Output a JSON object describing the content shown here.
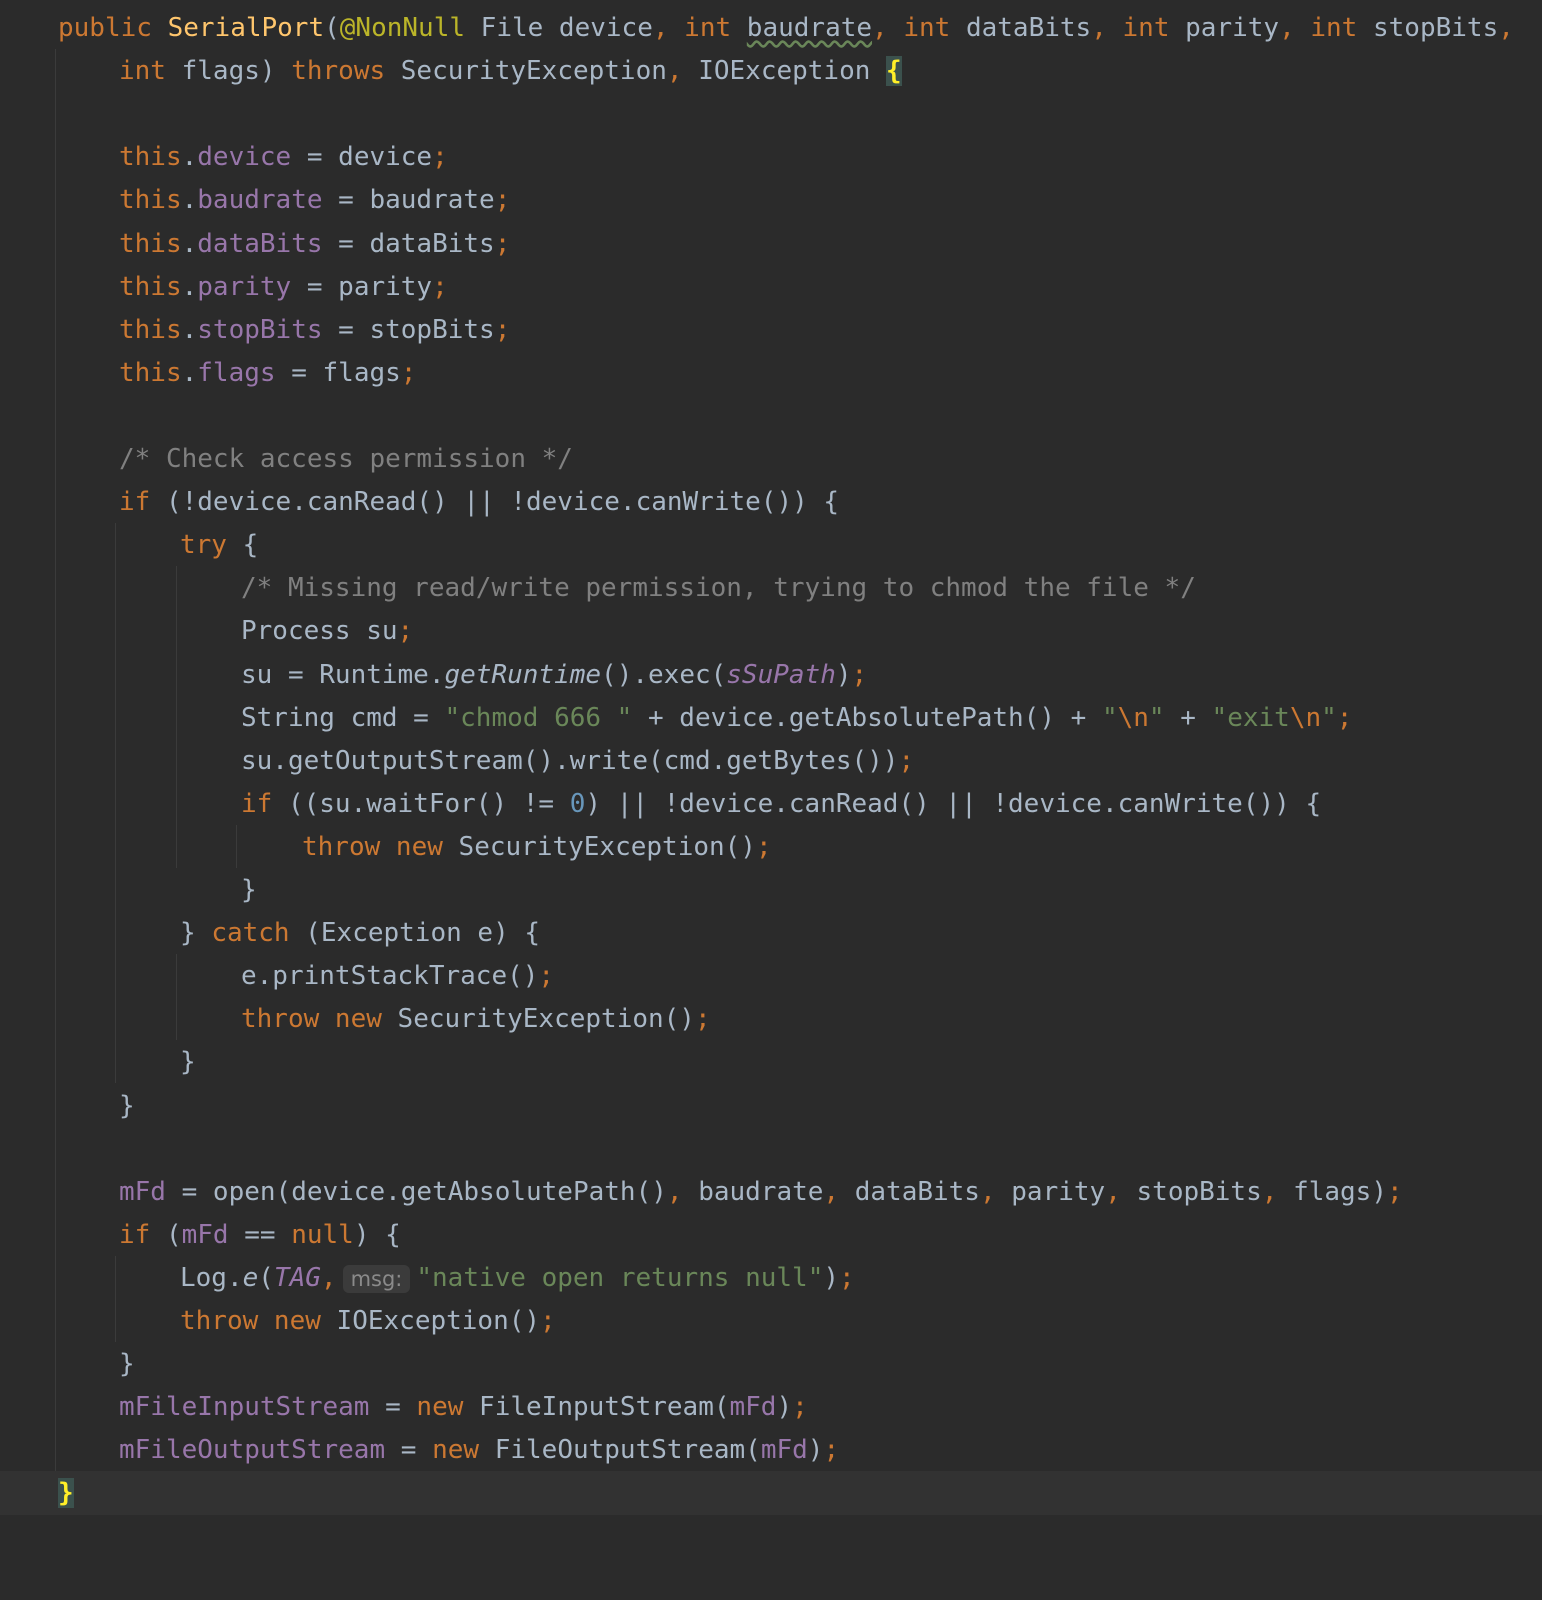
{
  "editor": {
    "language": "Java",
    "theme_colors": {
      "background": "#2b2b2b",
      "current_line": "#323232",
      "default_text": "#a9b7c6",
      "keyword": "#cc7832",
      "method_declaration": "#ffc66d",
      "annotation": "#bbb529",
      "field": "#9876aa",
      "string": "#6a8759",
      "number": "#6897bb",
      "comment": "#808080",
      "matched_brace": "#ffef28"
    },
    "lines": [
      [
        {
          "t": "public ",
          "c": "kw"
        },
        {
          "t": "SerialPort",
          "c": "fn"
        },
        {
          "t": "("
        },
        {
          "t": "@NonNull",
          "c": "ann"
        },
        {
          "t": " File device"
        },
        {
          "t": ", ",
          "c": "kw"
        },
        {
          "t": "int ",
          "c": "kw"
        },
        {
          "t": "baudrate",
          "c": "warn"
        },
        {
          "t": ", ",
          "c": "kw"
        },
        {
          "t": "int ",
          "c": "kw"
        },
        {
          "t": "dataBits"
        },
        {
          "t": ", ",
          "c": "kw"
        },
        {
          "t": "int ",
          "c": "kw"
        },
        {
          "t": "parity"
        },
        {
          "t": ", ",
          "c": "kw"
        },
        {
          "t": "int ",
          "c": "kw"
        },
        {
          "t": "stopBits"
        },
        {
          "t": ",",
          "c": "kw"
        }
      ],
      [
        {
          "t": "int ",
          "c": "kw"
        },
        {
          "t": "flags) "
        },
        {
          "t": "throws ",
          "c": "kw"
        },
        {
          "t": "SecurityException"
        },
        {
          "t": ", ",
          "c": "kw"
        },
        {
          "t": "IOException "
        },
        {
          "t": "{",
          "c": "brace-hl"
        }
      ],
      [],
      [
        {
          "t": "this",
          "c": "kw"
        },
        {
          "t": "."
        },
        {
          "t": "device",
          "c": "fld"
        },
        {
          "t": " = device"
        },
        {
          "t": ";",
          "c": "kw"
        }
      ],
      [
        {
          "t": "this",
          "c": "kw"
        },
        {
          "t": "."
        },
        {
          "t": "baudrate",
          "c": "fld"
        },
        {
          "t": " = baudrate"
        },
        {
          "t": ";",
          "c": "kw"
        }
      ],
      [
        {
          "t": "this",
          "c": "kw"
        },
        {
          "t": "."
        },
        {
          "t": "dataBits",
          "c": "fld"
        },
        {
          "t": " = dataBits"
        },
        {
          "t": ";",
          "c": "kw"
        }
      ],
      [
        {
          "t": "this",
          "c": "kw"
        },
        {
          "t": "."
        },
        {
          "t": "parity",
          "c": "fld"
        },
        {
          "t": " = parity"
        },
        {
          "t": ";",
          "c": "kw"
        }
      ],
      [
        {
          "t": "this",
          "c": "kw"
        },
        {
          "t": "."
        },
        {
          "t": "stopBits",
          "c": "fld"
        },
        {
          "t": " = stopBits"
        },
        {
          "t": ";",
          "c": "kw"
        }
      ],
      [
        {
          "t": "this",
          "c": "kw"
        },
        {
          "t": "."
        },
        {
          "t": "flags",
          "c": "fld"
        },
        {
          "t": " = flags"
        },
        {
          "t": ";",
          "c": "kw"
        }
      ],
      [],
      [
        {
          "t": "/* Check access permission */",
          "c": "cmt"
        }
      ],
      [
        {
          "t": "if ",
          "c": "kw"
        },
        {
          "t": "(!device.canRead() || !device.canWrite()) {"
        }
      ],
      [
        {
          "t": "try ",
          "c": "kw"
        },
        {
          "t": "{"
        }
      ],
      [
        {
          "t": "/* Missing read/write permission, trying to chmod the file */",
          "c": "cmt"
        }
      ],
      [
        {
          "t": "Process su"
        },
        {
          "t": ";",
          "c": "kw"
        }
      ],
      [
        {
          "t": "su = Runtime."
        },
        {
          "t": "getRuntime",
          "c": "ital"
        },
        {
          "t": "().exec("
        },
        {
          "t": "sSuPath",
          "c": "fldi"
        },
        {
          "t": ")"
        },
        {
          "t": ";",
          "c": "kw"
        }
      ],
      [
        {
          "t": "String cmd = "
        },
        {
          "t": "\"chmod 666 \"",
          "c": "str"
        },
        {
          "t": " + device.getAbsolutePath() + "
        },
        {
          "t": "\"",
          "c": "str"
        },
        {
          "t": "\\n",
          "c": "esc"
        },
        {
          "t": "\"",
          "c": "str"
        },
        {
          "t": " + "
        },
        {
          "t": "\"exit",
          "c": "str"
        },
        {
          "t": "\\n",
          "c": "esc"
        },
        {
          "t": "\"",
          "c": "str"
        },
        {
          "t": ";",
          "c": "kw"
        }
      ],
      [
        {
          "t": "su.getOutputStream().write(cmd.getBytes())"
        },
        {
          "t": ";",
          "c": "kw"
        }
      ],
      [
        {
          "t": "if ",
          "c": "kw"
        },
        {
          "t": "((su.waitFor() != "
        },
        {
          "t": "0",
          "c": "num"
        },
        {
          "t": ") || !device.canRead() || !device.canWrite()) {"
        }
      ],
      [
        {
          "t": "throw new ",
          "c": "kw"
        },
        {
          "t": "SecurityException()"
        },
        {
          "t": ";",
          "c": "kw"
        }
      ],
      [
        {
          "t": "}"
        }
      ],
      [
        {
          "t": "} "
        },
        {
          "t": "catch ",
          "c": "kw"
        },
        {
          "t": "(Exception e) {"
        }
      ],
      [
        {
          "t": "e.printStackTrace()"
        },
        {
          "t": ";",
          "c": "kw"
        }
      ],
      [
        {
          "t": "throw new ",
          "c": "kw"
        },
        {
          "t": "SecurityException()"
        },
        {
          "t": ";",
          "c": "kw"
        }
      ],
      [
        {
          "t": "}"
        }
      ],
      [
        {
          "t": "}"
        }
      ],
      [],
      [
        {
          "t": "mFd",
          "c": "fld"
        },
        {
          "t": " = open(device.getAbsolutePath()"
        },
        {
          "t": ", ",
          "c": "kw"
        },
        {
          "t": "baudrate"
        },
        {
          "t": ", ",
          "c": "kw"
        },
        {
          "t": "dataBits"
        },
        {
          "t": ", ",
          "c": "kw"
        },
        {
          "t": "parity"
        },
        {
          "t": ", ",
          "c": "kw"
        },
        {
          "t": "stopBits"
        },
        {
          "t": ", ",
          "c": "kw"
        },
        {
          "t": "flags)"
        },
        {
          "t": ";",
          "c": "kw"
        }
      ],
      [
        {
          "t": "if ",
          "c": "kw"
        },
        {
          "t": "("
        },
        {
          "t": "mFd",
          "c": "fld"
        },
        {
          "t": " == "
        },
        {
          "t": "null",
          "c": "kw"
        },
        {
          "t": ") {"
        }
      ],
      [
        {
          "t": "Log."
        },
        {
          "t": "e",
          "c": "ital"
        },
        {
          "t": "("
        },
        {
          "t": "TAG",
          "c": "fldi"
        },
        {
          "t": ",",
          "c": "kw"
        },
        {
          "t": "msg:",
          "c": "hint"
        },
        {
          "t": "\"native open returns null\"",
          "c": "str"
        },
        {
          "t": ")"
        },
        {
          "t": ";",
          "c": "kw"
        }
      ],
      [
        {
          "t": "throw new ",
          "c": "kw"
        },
        {
          "t": "IOException()"
        },
        {
          "t": ";",
          "c": "kw"
        }
      ],
      [
        {
          "t": "}"
        }
      ],
      [
        {
          "t": "mFileInputStream",
          "c": "fld"
        },
        {
          "t": " = "
        },
        {
          "t": "new ",
          "c": "kw"
        },
        {
          "t": "FileInputStream("
        },
        {
          "t": "mFd",
          "c": "fld"
        },
        {
          "t": ")"
        },
        {
          "t": ";",
          "c": "kw"
        }
      ],
      [
        {
          "t": "mFileOutputStream",
          "c": "fld"
        },
        {
          "t": " = "
        },
        {
          "t": "new ",
          "c": "kw"
        },
        {
          "t": "FileOutputStream("
        },
        {
          "t": "mFd",
          "c": "fld"
        },
        {
          "t": ")"
        },
        {
          "t": ";",
          "c": "kw"
        }
      ],
      [
        {
          "t": "}",
          "c": "brace-hl"
        }
      ]
    ]
  }
}
